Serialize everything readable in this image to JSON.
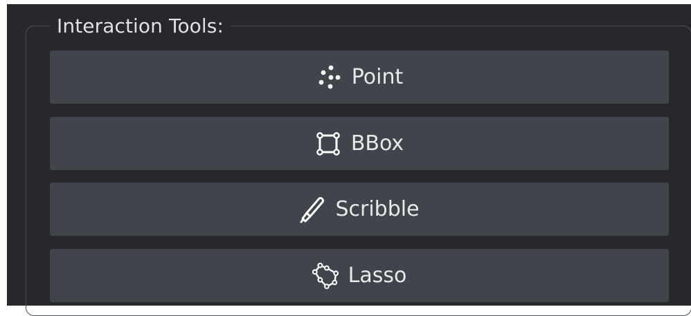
{
  "group": {
    "title": "Interaction Tools:"
  },
  "tools": [
    {
      "label": "Point",
      "icon": "point-icon"
    },
    {
      "label": "BBox",
      "icon": "bbox-icon"
    },
    {
      "label": "Scribble",
      "icon": "pen-icon"
    },
    {
      "label": "Lasso",
      "icon": "lasso-icon"
    }
  ],
  "colors": {
    "panel_background": "#26282c",
    "button_background": "#40444b",
    "text": "#e7e9ec",
    "group_border": "#4b4e54"
  }
}
